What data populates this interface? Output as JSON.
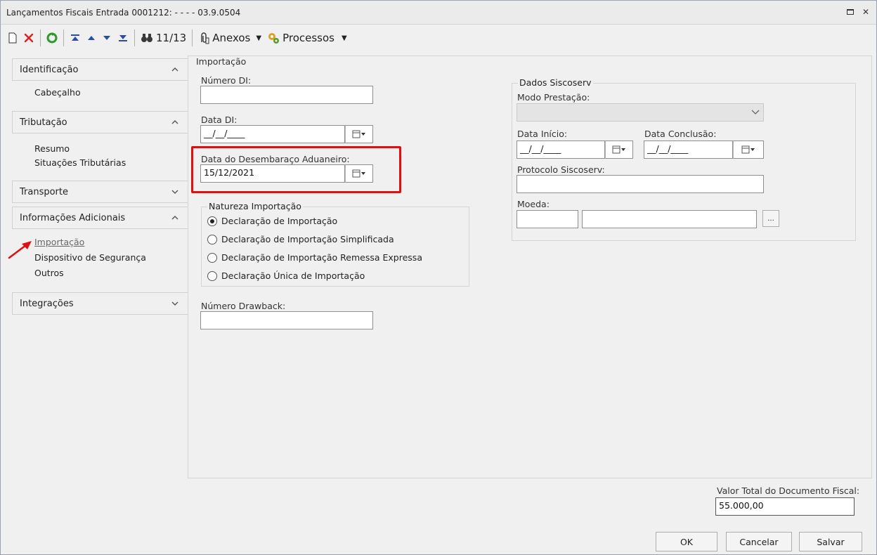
{
  "window": {
    "title": "Lançamentos Fiscais Entrada 0001212: - - - - 03.9.0504"
  },
  "toolbar": {
    "record_position": "11/13",
    "attachments_label": "Anexos",
    "processes_label": "Processos"
  },
  "sidebar": {
    "groups": [
      {
        "label": "Identificação",
        "items": [
          "Cabeçalho"
        ]
      },
      {
        "label": "Tributação",
        "items": [
          "Resumo",
          "Situações Tributárias"
        ]
      },
      {
        "label": "Transporte",
        "items": []
      },
      {
        "label": "Informações Adicionais",
        "items": [
          "Importação",
          "Dispositivo de Segurança",
          "Outros"
        ]
      },
      {
        "label": "Integrações",
        "items": []
      }
    ]
  },
  "main": {
    "section_title": "Importação",
    "numero_di": {
      "label": "Número DI:",
      "value": ""
    },
    "data_di": {
      "label": "Data DI:",
      "value": "__/__/____"
    },
    "data_desembaraco": {
      "label": "Data do Desembaraço Aduaneiro:",
      "value": "15/12/2021"
    },
    "natureza": {
      "legend": "Natureza Importação",
      "options": [
        {
          "label": "Declaração de Importação",
          "checked": true
        },
        {
          "label": "Declaração de Importação Simplificada",
          "checked": false
        },
        {
          "label": "Declaração de Importação Remessa Expressa",
          "checked": false
        },
        {
          "label": "Declaração Única de Importação",
          "checked": false
        }
      ]
    },
    "numero_drawback": {
      "label": "Número Drawback:",
      "value": ""
    }
  },
  "siscoserv": {
    "legend": "Dados Siscoserv",
    "modo_prestacao": {
      "label": "Modo Prestação:",
      "value": ""
    },
    "data_inicio": {
      "label": "Data Início:",
      "value": "__/__/____"
    },
    "data_conclusao": {
      "label": "Data Conclusão:",
      "value": "__/__/____"
    },
    "protocolo": {
      "label": "Protocolo Siscoserv:",
      "value": ""
    },
    "moeda": {
      "label": "Moeda:",
      "code": "",
      "name": "",
      "browse_label": "..."
    }
  },
  "footer": {
    "total_label": "Valor Total do Documento Fiscal:",
    "total_value": "55.000,00",
    "ok_label": "OK",
    "cancel_label": "Cancelar",
    "save_label": "Salvar"
  },
  "colors": {
    "highlight": "#e01010",
    "arrow": "#e01010"
  }
}
